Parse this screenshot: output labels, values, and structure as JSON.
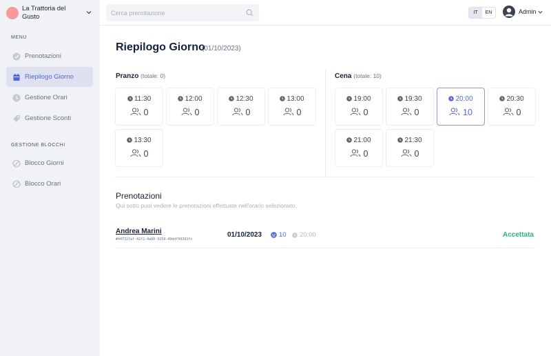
{
  "restaurant": {
    "name": "La Trattoria del Gusto",
    "logo_color": "#f49a9a"
  },
  "sidebar": {
    "menu_header": "MENU",
    "menu_items": [
      {
        "label": "Prenotazioni",
        "icon": "check-circle-icon",
        "active": false
      },
      {
        "label": "Riepilogo Giorno",
        "icon": "calendar-icon",
        "active": true
      },
      {
        "label": "Gestione Orari",
        "icon": "clock-icon",
        "active": false
      },
      {
        "label": "Gestione Sconti",
        "icon": "tag-icon",
        "active": false
      }
    ],
    "blocks_header": "GESTIONE BLOCCHI",
    "block_items": [
      {
        "label": "Blocco Giorni",
        "icon": "ban-icon"
      },
      {
        "label": "Blocco Orari",
        "icon": "ban-icon"
      }
    ]
  },
  "topbar": {
    "search_placeholder": "Cerca prenotazione",
    "lang": {
      "it": "IT",
      "en": "EN",
      "selected": "IT"
    },
    "user": "Admin"
  },
  "page": {
    "title": "Riepilogo Giorno",
    "date": "(01/10/2023)"
  },
  "pranzo": {
    "label": "Pranzo",
    "total": "(totale: 0)",
    "slots": [
      {
        "time": "11:30",
        "count": "0"
      },
      {
        "time": "12:00",
        "count": "0"
      },
      {
        "time": "12:30",
        "count": "0"
      },
      {
        "time": "13:00",
        "count": "0"
      },
      {
        "time": "13:30",
        "count": "0"
      }
    ]
  },
  "cena": {
    "label": "Cena",
    "total": "(totale: 10)",
    "slots": [
      {
        "time": "19:00",
        "count": "0"
      },
      {
        "time": "19:30",
        "count": "0"
      },
      {
        "time": "20:00",
        "count": "10",
        "selected": true
      },
      {
        "time": "20:30",
        "count": "0"
      },
      {
        "time": "21:00",
        "count": "0"
      },
      {
        "time": "21:30",
        "count": "0"
      }
    ]
  },
  "reservations": {
    "title": "Prenotazioni",
    "subtitle": "Qui sotto puoi vedere le prenotazioni effettuate nell'orario selezionato.",
    "rows": [
      {
        "name": "Andrea Marini",
        "id": "#44732faf-42f2-4a80-9259-49ddf90391fc",
        "date": "01/10/2023",
        "guests": "10",
        "time": "20:00",
        "status": "Accettata"
      }
    ]
  },
  "colors": {
    "accent": "#5467d6",
    "success": "#2bb37a",
    "sidebar_bg": "#f1f2f6",
    "active_bg": "#dde1f0"
  }
}
